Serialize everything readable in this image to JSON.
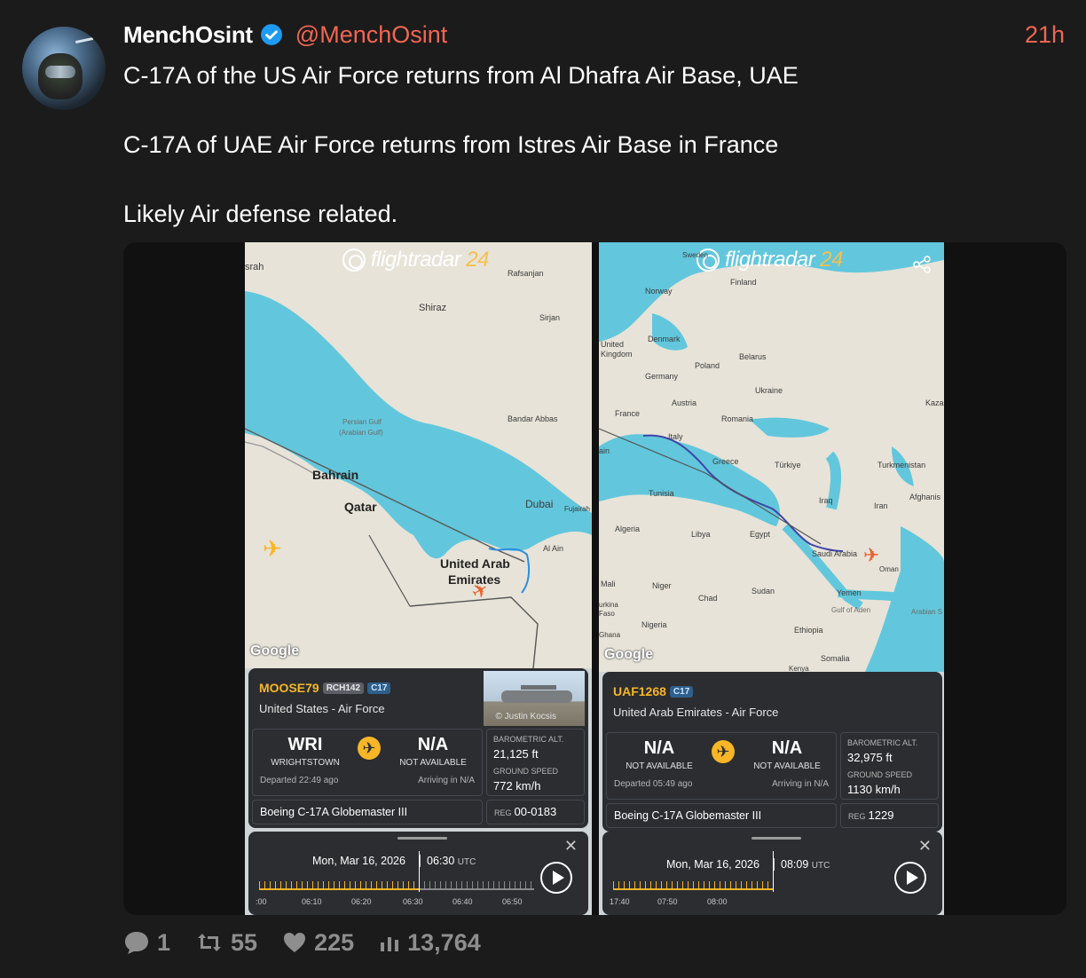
{
  "post": {
    "author": "MenchOsint",
    "handle": "@MenchOsint",
    "time": "21h",
    "text": "C-17A of the US Air Force returns from Al Dhafra Air Base, UAE\n\nC-17A of UAE Air Force returns from Istres Air Base in France\n\nLikely Air defense related.",
    "stats": {
      "replies": "1",
      "reposts": "55",
      "likes": "225",
      "views": "13,764"
    }
  },
  "map1": {
    "brand": "flightradar",
    "brand_num": "24",
    "labels": {
      "bahrain": "Bahrain",
      "qatar": "Qatar",
      "uae1": "United Arab",
      "uae2": "Emirates",
      "dubai": "Dubai",
      "shiraz": "Shiraz",
      "rafsanjan": "Rafsanjan",
      "sirjan": "Sirjan",
      "bandar": "Bandar Abbas",
      "gulf1": "Persian Gulf",
      "gulf2": "(Arabian Gulf)",
      "alain": "Al Ain",
      "fujairah": "Fujairah",
      "srah": "srah"
    },
    "google": "Google",
    "card": {
      "flight": "MOOSE79",
      "badge1": "RCH142",
      "badge2": "C17",
      "operator": "United States - Air Force",
      "credit": "© Justin Kocsis",
      "from_code": "WRI",
      "from_city": "WRIGHTSTOWN",
      "to_code": "N/A",
      "to_city": "NOT AVAILABLE",
      "departed": "Departed 22:49 ago",
      "arriving": "Arriving in N/A",
      "baro_label": "BAROMETRIC ALT.",
      "baro": "21,125 ft",
      "speed_label": "GROUND SPEED",
      "speed": "772 km/h",
      "model": "Boeing C-17A Globemaster III",
      "reg_label": "REG",
      "reg": "00-0183"
    },
    "playback": {
      "date": "Mon, Mar 16, 2026",
      "time": "06:30",
      "utc": "UTC",
      "ticks": [
        ":00",
        "06:10",
        "06:20",
        "06:30",
        "06:40",
        "06:50"
      ]
    }
  },
  "map2": {
    "brand": "flightradar",
    "brand_num": "24",
    "labels": {
      "norway": "Norway",
      "finland": "Finland",
      "sweden": "Sweden",
      "uk1": "United",
      "uk2": "Kingdom",
      "denmark": "Denmark",
      "poland": "Poland",
      "belarus": "Belarus",
      "germany": "Germany",
      "ukraine": "Ukraine",
      "france": "France",
      "austria": "Austria",
      "romania": "Romania",
      "italy": "Italy",
      "spain": "ain",
      "greece": "Greece",
      "turkiye": "Türkiye",
      "turkmenistan": "Turkmenistan",
      "kaza": "Kaza",
      "afghan": "Afghanis",
      "tunisia": "Tunisia",
      "iraq": "Iraq",
      "iran": "Iran",
      "algeria": "Algeria",
      "libya": "Libya",
      "egypt": "Egypt",
      "saudi": "Saudi Arabia",
      "oman": "Oman",
      "mali": "Mali",
      "niger": "Niger",
      "chad": "Chad",
      "sudan": "Sudan",
      "yemen": "Yemen",
      "burkina1": "urkina",
      "burkina2": "Faso",
      "nigeria": "Nigeria",
      "ghana": "Ghana",
      "ethiopia": "Ethiopia",
      "somalia": "Somalia",
      "aden": "Gulf of Aden",
      "arabian": "Arabian S",
      "kenya": "Kenya"
    },
    "google": "Google",
    "card": {
      "flight": "UAF1268",
      "badge2": "C17",
      "operator": "United Arab Emirates - Air Force",
      "from_code": "N/A",
      "from_city": "NOT AVAILABLE",
      "to_code": "N/A",
      "to_city": "NOT AVAILABLE",
      "departed": "Departed 05:49 ago",
      "arriving": "Arriving in N/A",
      "baro_label": "BAROMETRIC ALT.",
      "baro": "32,975 ft",
      "speed_label": "GROUND SPEED",
      "speed": "1130 km/h",
      "model": "Boeing C-17A Globemaster III",
      "reg_label": "REG",
      "reg": "1229"
    },
    "playback": {
      "date": "Mon, Mar 16, 2026",
      "time": "08:09",
      "utc": "UTC",
      "ticks": [
        "17:40",
        "07:50",
        "08:00"
      ]
    }
  },
  "colors": {
    "accent": "#f26652",
    "fr_yellow": "#f6b626",
    "sea": "#62c7dc"
  },
  "icons": [
    "verified-badge-icon",
    "reply-icon",
    "repost-icon",
    "like-icon",
    "views-icon",
    "play-icon",
    "close-icon",
    "plane-icon",
    "share-icon"
  ]
}
